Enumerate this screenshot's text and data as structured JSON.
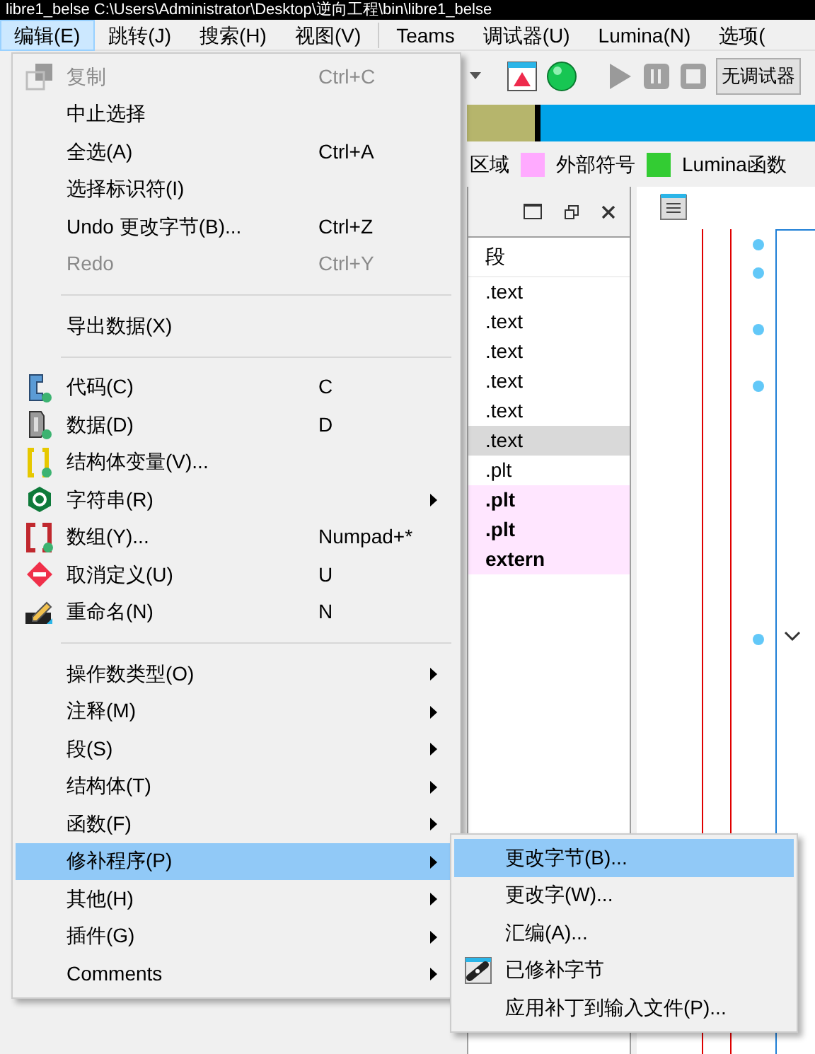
{
  "window": {
    "title": "libre1_belse C:\\Users\\Administrator\\Desktop\\逆向工程\\bin\\libre1_belse"
  },
  "menu_bar": [
    {
      "label": "编辑(E)",
      "selected": true
    },
    {
      "label": "跳转(J)",
      "selected": false
    },
    {
      "label": "搜索(H)",
      "selected": false
    },
    {
      "label": "视图(V)",
      "selected": false
    },
    {
      "label": "Teams",
      "selected": false
    },
    {
      "label": "调试器(U)",
      "selected": false
    },
    {
      "label": "Lumina(N)",
      "selected": false
    },
    {
      "label": "选项(",
      "selected": false
    }
  ],
  "toolbar": {
    "debugger_select": "无调试器"
  },
  "legend": [
    {
      "label": "区域"
    },
    {
      "label": "外部符号",
      "color": "#ffaaff"
    },
    {
      "label": "Lumina函数",
      "color": "#33cc33"
    }
  ],
  "segments_panel": {
    "columns": [
      "段"
    ],
    "rows": [
      {
        "segment": ".text",
        "selected": false,
        "kind": "normal"
      },
      {
        "segment": ".text",
        "selected": false,
        "kind": "normal"
      },
      {
        "segment": ".text",
        "selected": false,
        "kind": "normal"
      },
      {
        "segment": ".text",
        "selected": false,
        "kind": "normal"
      },
      {
        "segment": ".text",
        "selected": false,
        "kind": "normal"
      },
      {
        "segment": ".text",
        "selected": true,
        "kind": "normal"
      },
      {
        "segment": ".plt",
        "selected": false,
        "kind": "normal"
      },
      {
        "segment": ".plt",
        "selected": false,
        "kind": "import"
      },
      {
        "segment": ".plt",
        "selected": false,
        "kind": "import"
      },
      {
        "segment": "extern",
        "selected": false,
        "kind": "import"
      }
    ]
  },
  "edit_menu": {
    "sections": [
      [
        {
          "label": "复制",
          "shortcut": "Ctrl+C",
          "disabled": true,
          "submenu": false,
          "selected": false
        },
        {
          "label": "中止选择",
          "disabled": false,
          "submenu": false,
          "selected": false
        },
        {
          "label": "全选(A)",
          "shortcut": "Ctrl+A",
          "disabled": false,
          "submenu": false,
          "selected": false
        },
        {
          "label": "选择标识符(I)",
          "disabled": false,
          "submenu": false,
          "selected": false
        },
        {
          "label": "Undo 更改字节(B)...",
          "shortcut": "Ctrl+Z",
          "disabled": false,
          "submenu": false,
          "selected": false
        },
        {
          "label": "Redo",
          "shortcut": "Ctrl+Y",
          "disabled": true,
          "submenu": false,
          "selected": false
        }
      ],
      [
        {
          "label": "导出数据(X)",
          "disabled": false,
          "submenu": false,
          "selected": false
        }
      ],
      [
        {
          "label": "代码(C)",
          "shortcut": "C",
          "disabled": false,
          "submenu": false,
          "selected": false
        },
        {
          "label": "数据(D)",
          "shortcut": "D",
          "disabled": false,
          "submenu": false,
          "selected": false
        },
        {
          "label": "结构体变量(V)...",
          "disabled": false,
          "submenu": false,
          "selected": false
        },
        {
          "label": "字符串(R)",
          "disabled": false,
          "submenu": true,
          "selected": false
        },
        {
          "label": "数组(Y)...",
          "shortcut": "Numpad+*",
          "disabled": false,
          "submenu": false,
          "selected": false
        },
        {
          "label": "取消定义(U)",
          "shortcut": "U",
          "disabled": false,
          "submenu": false,
          "selected": false
        },
        {
          "label": "重命名(N)",
          "shortcut": "N",
          "disabled": false,
          "submenu": false,
          "selected": false
        }
      ],
      [
        {
          "label": "操作数类型(O)",
          "disabled": false,
          "submenu": true,
          "selected": false
        },
        {
          "label": "注释(M)",
          "disabled": false,
          "submenu": true,
          "selected": false
        },
        {
          "label": "段(S)",
          "disabled": false,
          "submenu": true,
          "selected": false
        },
        {
          "label": "结构体(T)",
          "disabled": false,
          "submenu": true,
          "selected": false
        },
        {
          "label": "函数(F)",
          "disabled": false,
          "submenu": true,
          "selected": false
        },
        {
          "label": "修补程序(P)",
          "disabled": false,
          "submenu": true,
          "selected": true
        },
        {
          "label": "其他(H)",
          "disabled": false,
          "submenu": true,
          "selected": false
        },
        {
          "label": "插件(G)",
          "disabled": false,
          "submenu": true,
          "selected": false
        },
        {
          "label": "Comments",
          "disabled": false,
          "submenu": true,
          "selected": false
        }
      ]
    ]
  },
  "patch_submenu": [
    {
      "label": "更改字节(B)...",
      "selected": true
    },
    {
      "label": "更改字(W)...",
      "selected": false
    },
    {
      "label": "汇编(A)...",
      "selected": false
    },
    {
      "label": "已修补字节",
      "selected": false
    },
    {
      "label": "应用补丁到输入文件(P)...",
      "selected": false
    }
  ]
}
